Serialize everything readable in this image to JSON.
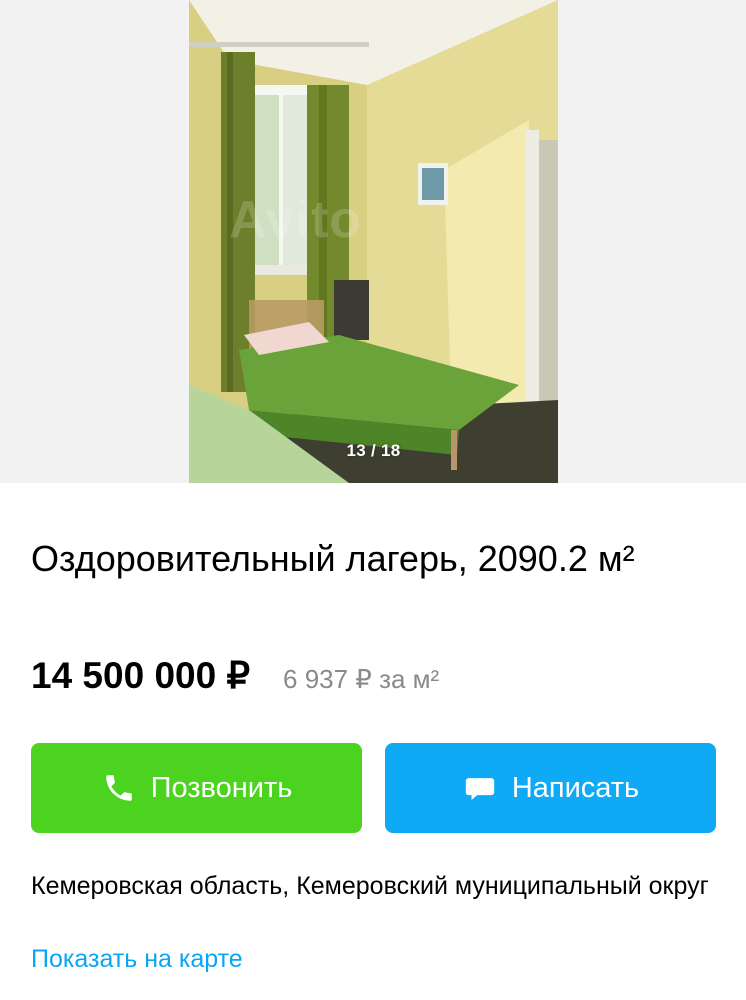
{
  "gallery": {
    "counter": "13 / 18",
    "watermark": "Avito"
  },
  "listing": {
    "title": "Оздоровительный лагерь, 2090.2 м²",
    "price": "14 500 000 ₽",
    "price_per_m": "6 937 ₽ за м²"
  },
  "actions": {
    "call_label": "Позвонить",
    "call_icon": "phone-icon",
    "write_label": "Написать",
    "write_icon": "chat-bubble-icon"
  },
  "location": {
    "address": "Кемеровская область, Кемеровский муниципальный округ",
    "map_link": "Показать на карте"
  },
  "colors": {
    "call_button": "#4bd31f",
    "write_button": "#0faaf5",
    "link": "#0aa5f3",
    "muted_text": "#8a8a8a"
  }
}
